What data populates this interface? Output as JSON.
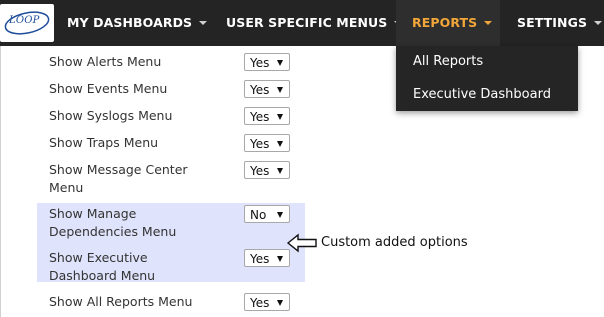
{
  "logo": {
    "text": "LOOP"
  },
  "nav": {
    "items": [
      {
        "label": "MY DASHBOARDS"
      },
      {
        "label": "USER SPECIFIC MENUS"
      },
      {
        "label": "REPORTS"
      },
      {
        "label": "SETTINGS"
      }
    ],
    "active_color": "#f1a63a"
  },
  "reports_dropdown": {
    "items": [
      {
        "label": "All Reports"
      },
      {
        "label": "Executive Dashboard"
      }
    ]
  },
  "settings": {
    "rows": [
      {
        "label": "Show Alerts Menu",
        "value": "Yes"
      },
      {
        "label": "Show Events Menu",
        "value": "Yes"
      },
      {
        "label": "Show Syslogs Menu",
        "value": "Yes"
      },
      {
        "label": "Show Traps Menu",
        "value": "Yes"
      },
      {
        "label": "Show Message Center Menu",
        "value": "Yes"
      },
      {
        "label": "Show Manage Dependencies Menu",
        "value": "No"
      },
      {
        "label": "Show Executive Dashboard Menu",
        "value": "Yes"
      },
      {
        "label": "Show All Reports Menu",
        "value": "Yes"
      }
    ],
    "highlight_color": "#dfe3fb"
  },
  "annotation": {
    "text": "Custom added options"
  }
}
